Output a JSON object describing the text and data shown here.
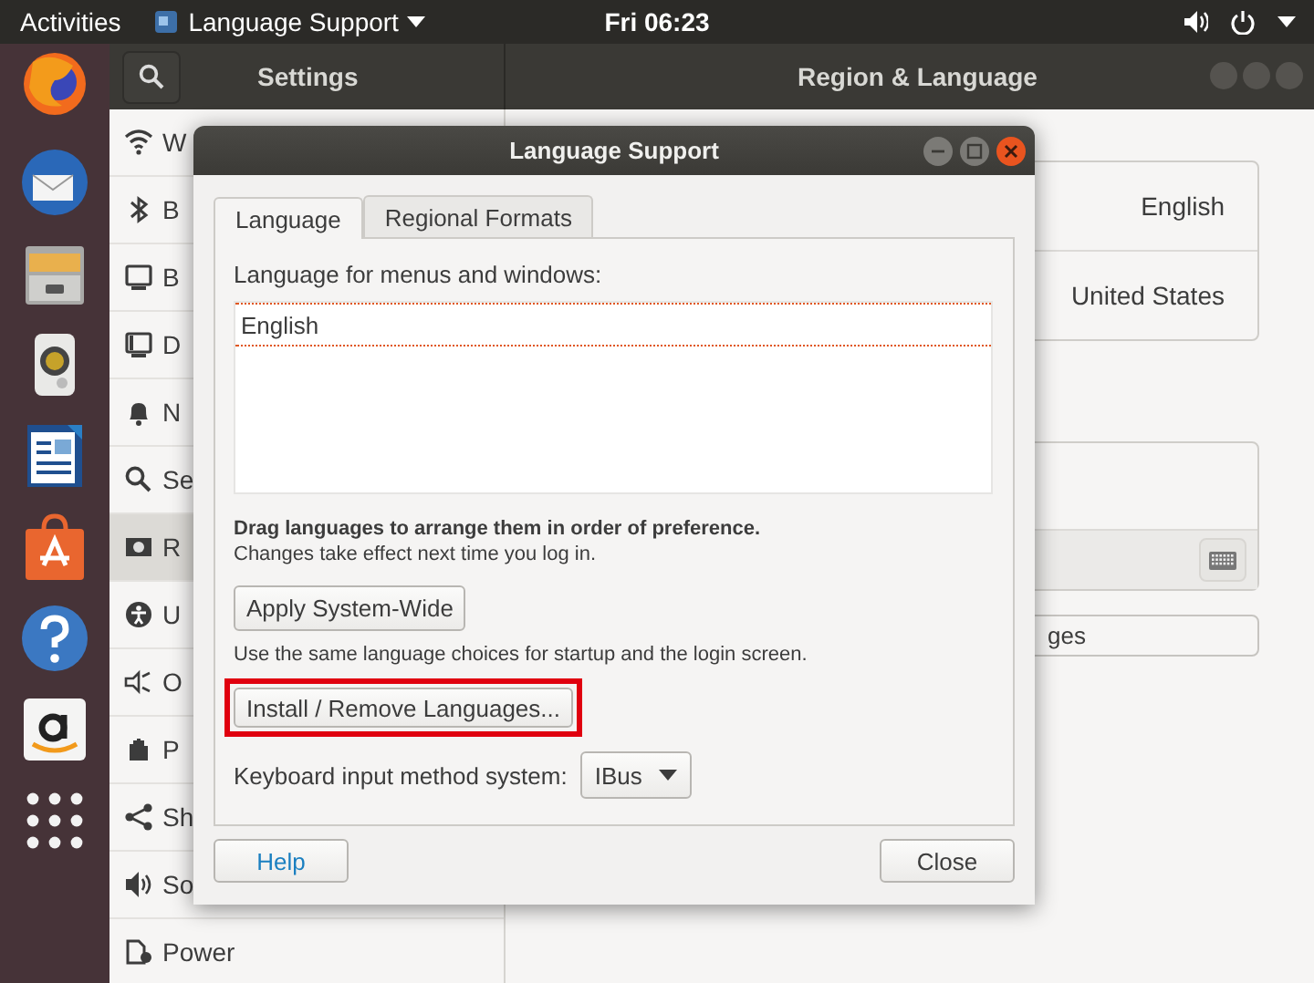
{
  "top_bar": {
    "activities": "Activities",
    "app_menu": "Language Support",
    "clock": "Fri 06:23"
  },
  "settings_window": {
    "header_title": "Settings",
    "panel_title": "Region & Language",
    "sidebar": {
      "items": [
        {
          "label": "W",
          "selected": false
        },
        {
          "label": "B",
          "selected": false
        },
        {
          "label": "B",
          "selected": false
        },
        {
          "label": "D",
          "selected": false
        },
        {
          "label": "N",
          "selected": false
        },
        {
          "label": "Se",
          "selected": false
        },
        {
          "label": "R",
          "selected": true
        },
        {
          "label": "U",
          "selected": false
        },
        {
          "label": "O",
          "selected": false
        },
        {
          "label": "P",
          "selected": false
        },
        {
          "label": "Sh",
          "selected": false
        },
        {
          "label": "So",
          "selected": false
        },
        {
          "label": "Power",
          "selected": false
        }
      ]
    },
    "panel": {
      "rows": [
        {
          "value": "English"
        },
        {
          "value": "United States"
        }
      ],
      "button_fragment": "ges"
    }
  },
  "dialog": {
    "title": "Language Support",
    "tabs": [
      {
        "label": "Language",
        "selected": true
      },
      {
        "label": "Regional Formats",
        "selected": false
      }
    ],
    "list_label": "Language for menus and windows:",
    "languages": [
      {
        "label": "English"
      }
    ],
    "hint_bold": "Drag languages to arrange them in order of preference.",
    "hint": "Changes take effect next time you log in.",
    "apply_button": "Apply System-Wide",
    "apply_note": "Use the same language choices for startup and the login screen.",
    "install_button": {
      "label": "Install / Remove Languages...",
      "highlighted": true
    },
    "input_method": {
      "label": "Keyboard input method system:",
      "value": "IBus"
    },
    "buttons": [
      {
        "label": "Help",
        "kind": "help"
      },
      {
        "label": "Close",
        "kind": "close"
      }
    ]
  }
}
